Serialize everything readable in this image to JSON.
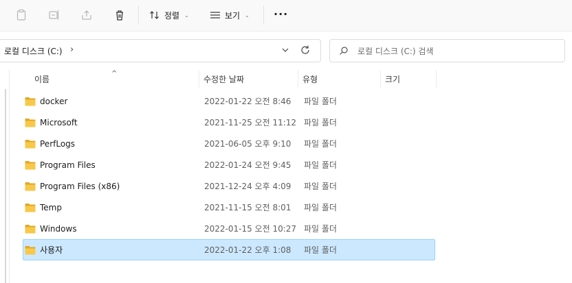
{
  "toolbar": {
    "buttons": [
      {
        "name": "paste-icon"
      },
      {
        "name": "rename-icon"
      },
      {
        "name": "share-icon"
      },
      {
        "name": "delete-icon"
      }
    ],
    "sort_label": "정렬",
    "view_label": "보기",
    "more_label": "···"
  },
  "address": {
    "path": "로컬 디스크 (C:)",
    "chevron": "›"
  },
  "search": {
    "placeholder": "로컬 디스크 (C:) 검색"
  },
  "columns": {
    "name": "이름",
    "modified": "수정한 날짜",
    "type": "유형",
    "size": "크기"
  },
  "sort_indicator": "^",
  "files": [
    {
      "name": "docker",
      "modified": "2022-01-22 오전 8:46",
      "type": "파일 폴더",
      "selected": false
    },
    {
      "name": "Microsoft",
      "modified": "2021-11-25 오전 11:12",
      "type": "파일 폴더",
      "selected": false
    },
    {
      "name": "PerfLogs",
      "modified": "2021-06-05 오후 9:10",
      "type": "파일 폴더",
      "selected": false
    },
    {
      "name": "Program Files",
      "modified": "2022-01-24 오전 9:45",
      "type": "파일 폴더",
      "selected": false
    },
    {
      "name": "Program Files (x86)",
      "modified": "2021-12-24 오후 4:09",
      "type": "파일 폴더",
      "selected": false
    },
    {
      "name": "Temp",
      "modified": "2021-11-15 오전 8:01",
      "type": "파일 폴더",
      "selected": false
    },
    {
      "name": "Windows",
      "modified": "2022-01-15 오전 10:27",
      "type": "파일 폴더",
      "selected": false
    },
    {
      "name": "사용자",
      "modified": "2022-01-22 오후 1:08",
      "type": "파일 폴더",
      "selected": true
    }
  ],
  "colors": {
    "selection_bg": "#cce8ff",
    "selection_border": "#99d1ff",
    "folder_yellow": "#f8c84a",
    "folder_dark": "#e3a826"
  }
}
